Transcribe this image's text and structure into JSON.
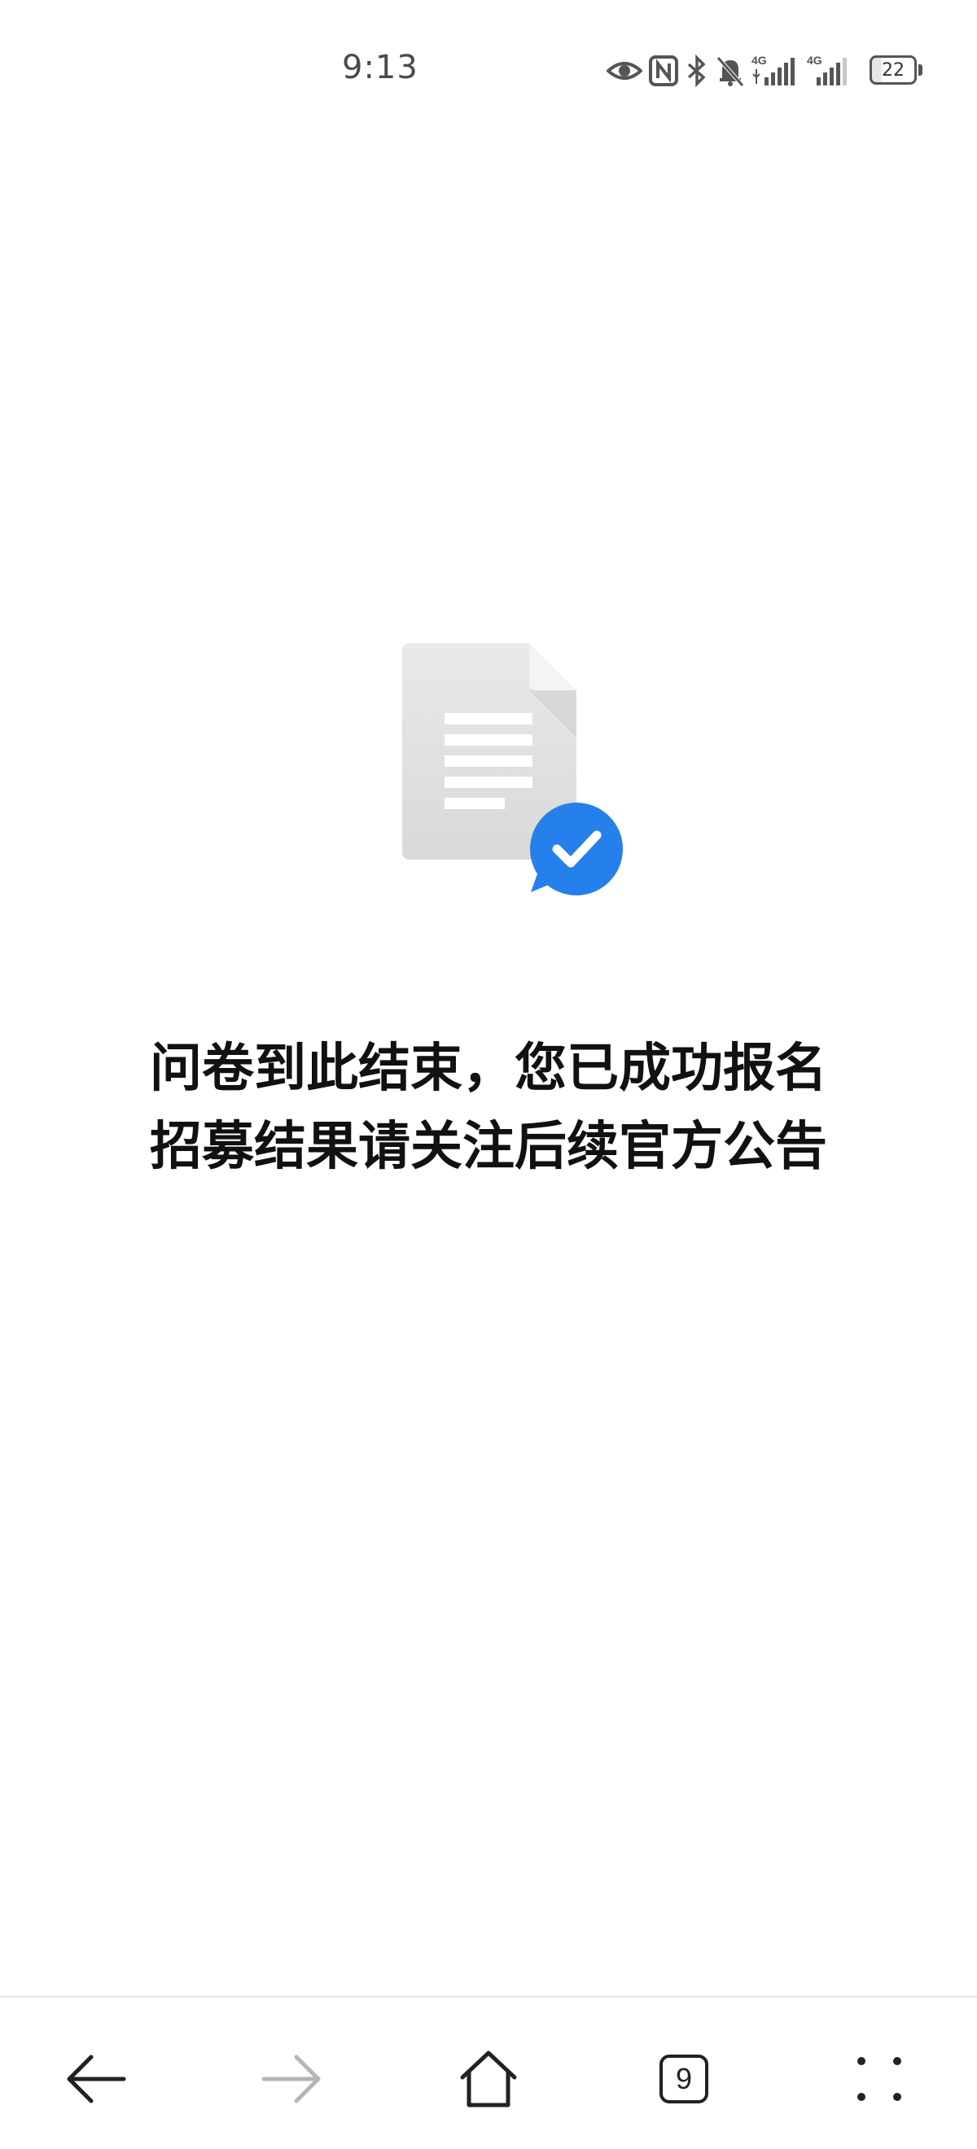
{
  "status_bar": {
    "time": "9:13",
    "battery_level": "22",
    "icons": [
      "eye-icon",
      "nfc-icon",
      "bluetooth-icon",
      "bell-mute-icon",
      "signal-4g-icon",
      "signal-4g-icon"
    ],
    "signal_labels": [
      "4G",
      "4G"
    ]
  },
  "main": {
    "illustration": "document-check-icon",
    "accent_color": "#2680eb",
    "message_line1": "问卷到此结束，您已成功报名",
    "message_line2": "招募结果请关注后续官方公告"
  },
  "bottom_nav": {
    "back": "back-arrow-icon",
    "forward": "forward-arrow-icon",
    "home": "home-icon",
    "tab_count": "9",
    "menu": "menu-dots-icon"
  }
}
